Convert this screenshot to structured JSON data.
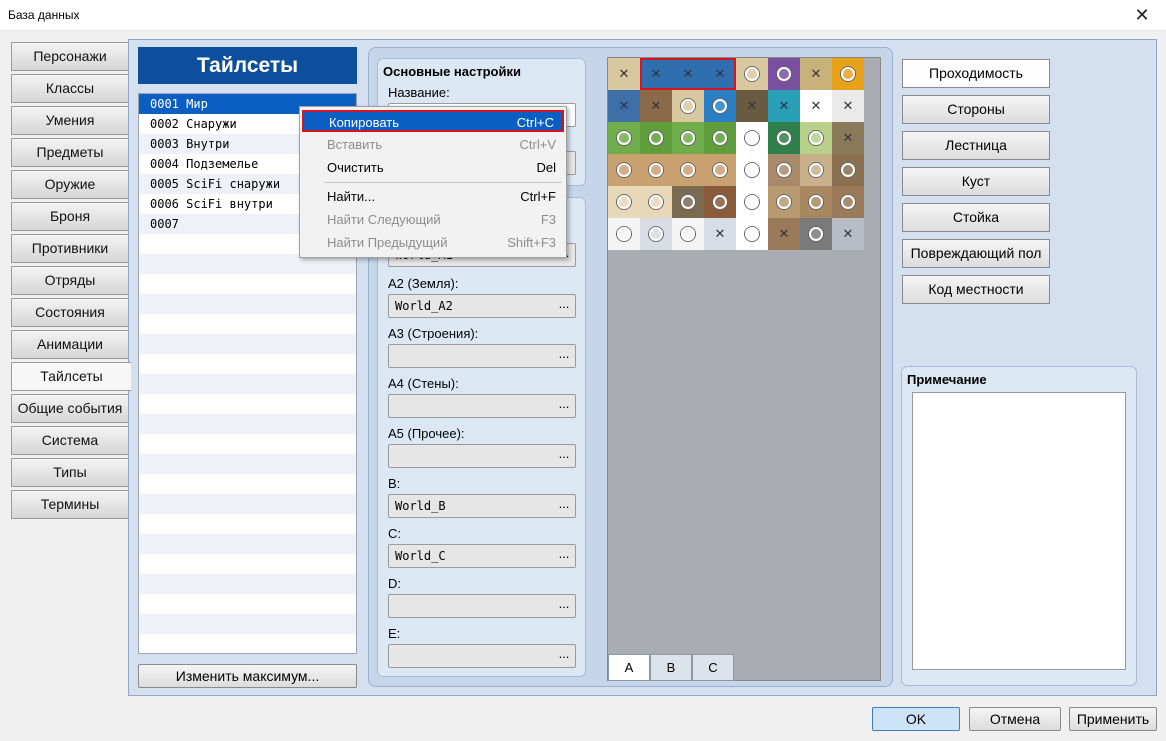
{
  "window": {
    "title": "База данных",
    "close_glyph": "✕"
  },
  "categories": [
    "Персонажи",
    "Классы",
    "Умения",
    "Предметы",
    "Оружие",
    "Броня",
    "Противники",
    "Отряды",
    "Состояния",
    "Анимации",
    "Тайлсеты",
    "Общие события",
    "Система",
    "Типы",
    "Термины"
  ],
  "active_category": "Тайлсеты",
  "list": {
    "header": "Тайлсеты",
    "rows": [
      "0001 Мир",
      "0002 Снаружи",
      "0003 Внутри",
      "0004 Подземелье",
      "0005 SciFi снаружи",
      "0006 SciFi внутри",
      "0007"
    ],
    "selected_index": 0,
    "change_max_label": "Изменить максимум..."
  },
  "settings": {
    "group_title": "Основные настройки",
    "name_label": "Название:",
    "fields": [
      {
        "label": "A2 (Земля):",
        "value": "World_A2"
      },
      {
        "label": "A3 (Строения):",
        "value": ""
      },
      {
        "label": "A4 (Стены):",
        "value": ""
      },
      {
        "label": "A5 (Прочее):",
        "value": ""
      },
      {
        "label": "B:",
        "value": "World_B"
      },
      {
        "label": "C:",
        "value": "World_C"
      },
      {
        "label": "D:",
        "value": ""
      },
      {
        "label": "E:",
        "value": ""
      }
    ],
    "a1_partial_value": "World_A1",
    "dots": "..."
  },
  "tile_tabs": [
    "A",
    "B",
    "C"
  ],
  "active_tile_tab": "A",
  "right_buttons": [
    "Проходимость",
    "Стороны",
    "Лестница",
    "Куст",
    "Стойка",
    "Повреждающий пол",
    "Код местности"
  ],
  "active_right_button": "Проходимость",
  "note": {
    "label": "Примечание"
  },
  "footer": {
    "ok": "OK",
    "cancel": "Отмена",
    "apply": "Применить"
  },
  "context_menu": [
    {
      "label": "Копировать",
      "shortcut": "Ctrl+C",
      "state": "highlighted"
    },
    {
      "label": "Вставить",
      "shortcut": "Ctrl+V",
      "state": "disabled"
    },
    {
      "label": "Очистить",
      "shortcut": "Del",
      "state": "enabled"
    },
    {
      "label": "Найти...",
      "shortcut": "Ctrl+F",
      "state": "enabled"
    },
    {
      "label": "Найти Следующий",
      "shortcut": "F3",
      "state": "disabled"
    },
    {
      "label": "Найти Предыдущий",
      "shortcut": "Shift+F3",
      "state": "disabled"
    }
  ],
  "colors": {
    "accent": "#0c5fc2",
    "header_blue": "#0c4f9c",
    "highlight_border": "#d9141e",
    "panel": "#d4e0ef"
  }
}
